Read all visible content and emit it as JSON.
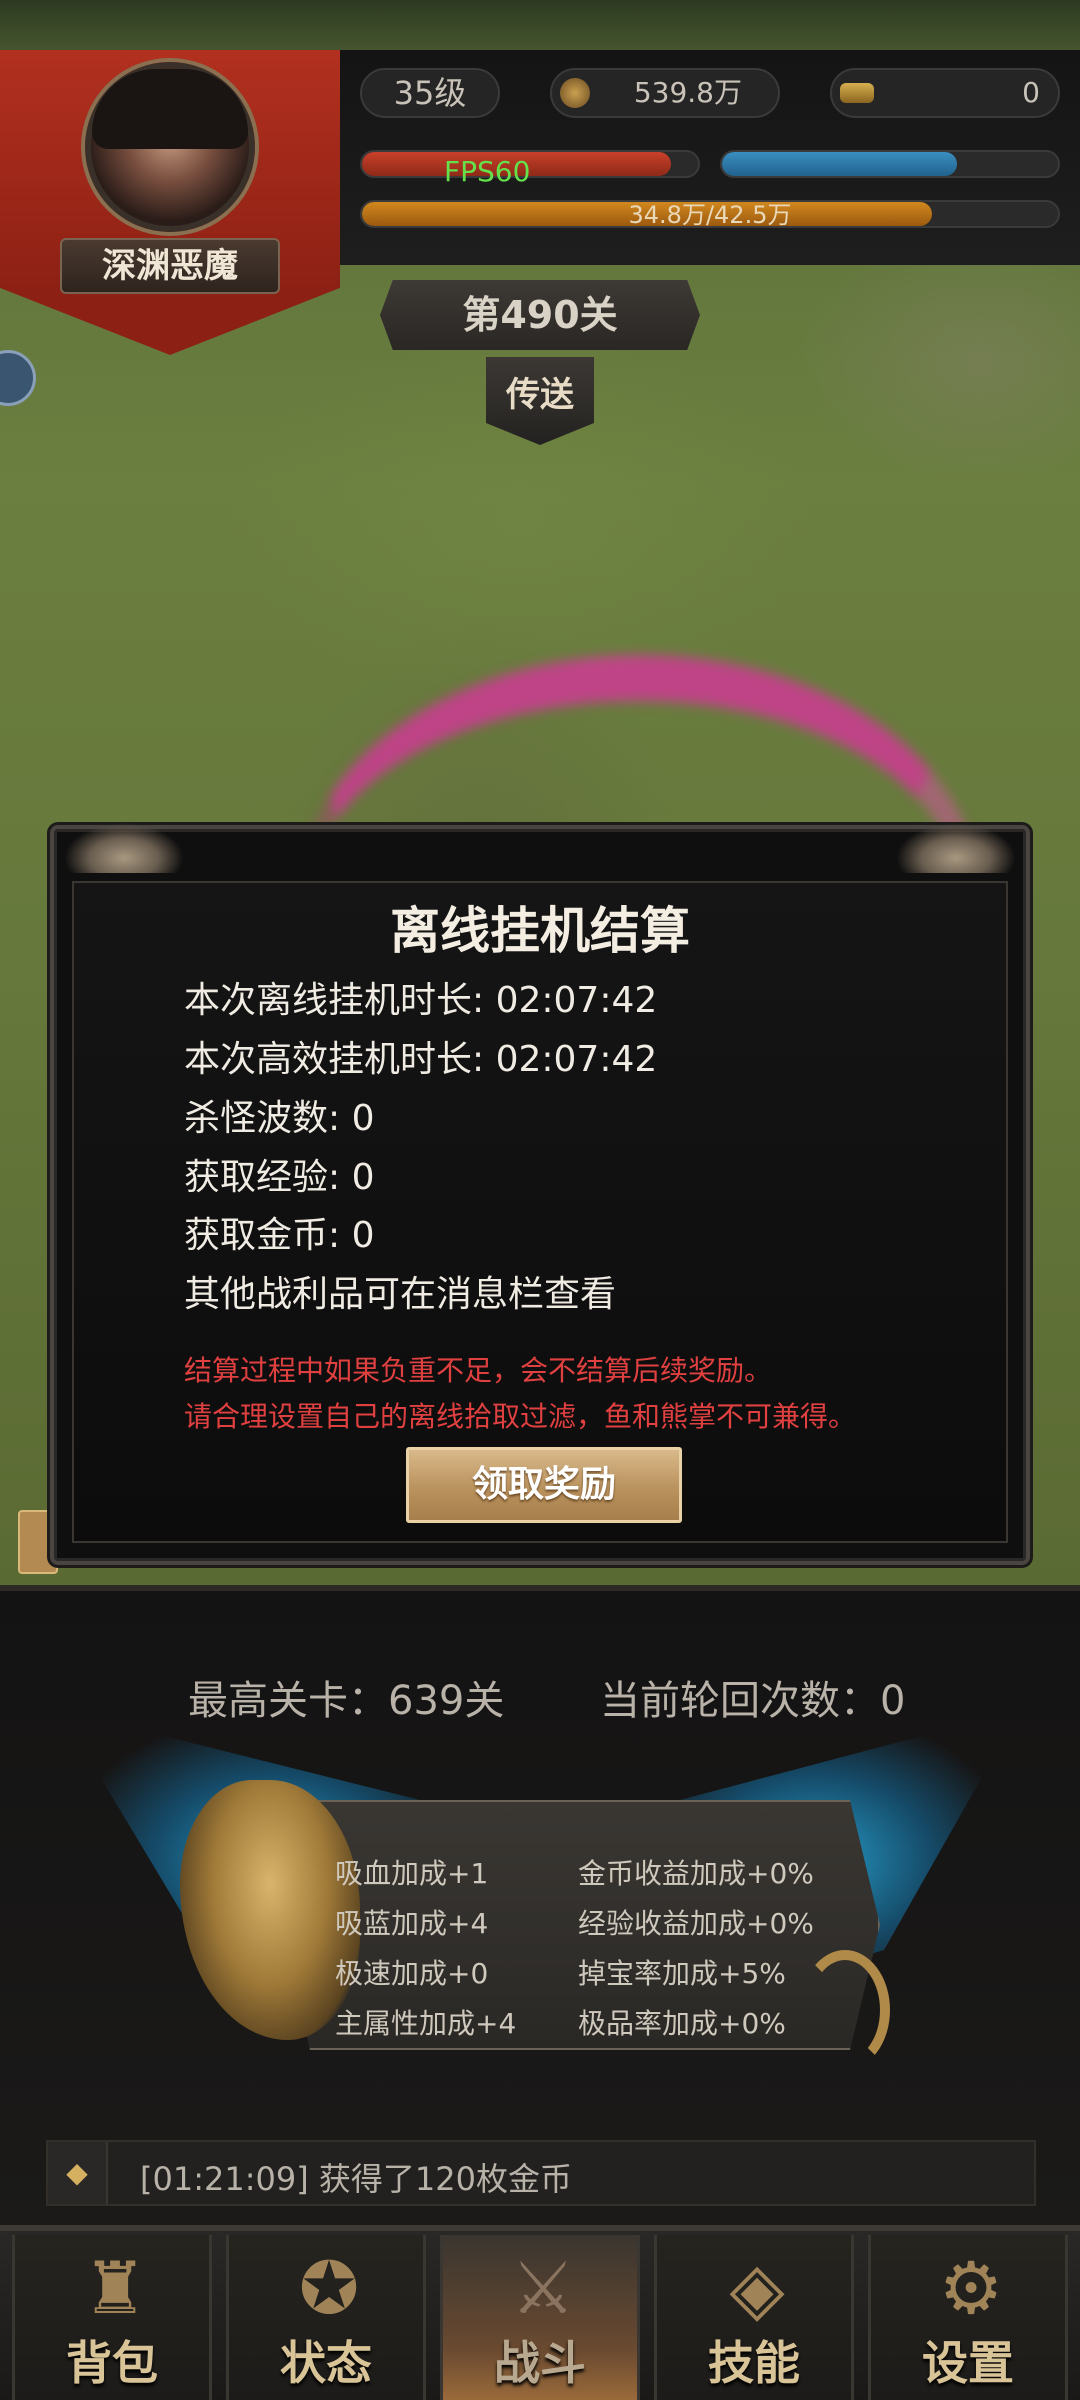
{
  "player": {
    "name": "深渊恶魔",
    "level": "35级",
    "gold": "539.8万",
    "ingots": "0",
    "fps": "FPS60",
    "hp_fraction": 0.92,
    "mp_fraction": 0.7,
    "xp_text": "34.8万/42.5万",
    "xp_fraction": 0.819
  },
  "stage": {
    "label": "第490关",
    "teleport_label": "传送"
  },
  "modal": {
    "title": "离线挂机结算",
    "lines": [
      "本次离线挂机时长: 02:07:42",
      "本次高效挂机时长: 02:07:42",
      "杀怪波数: 0",
      "获取经验: 0",
      "获取金币: 0",
      "其他战利品可在消息栏查看"
    ],
    "warnings": [
      "结算过程中如果负重不足，会不结算后续奖励。",
      "请合理设置自己的离线拾取过滤，鱼和熊掌不可兼得。"
    ],
    "claim_label": "领取奖励"
  },
  "panel": {
    "max_stage": "最高关卡：639关",
    "rebirth": "当前轮回次数：0",
    "attrs_left": [
      "吸血加成+1",
      "吸蓝加成+4",
      "极速加成+0",
      "主属性加成+4"
    ],
    "attrs_right": [
      "金币收益加成+0%",
      "经验收益加成+0%",
      "掉宝率加成+5%",
      "极品率加成+0%"
    ]
  },
  "log": {
    "message": "[01:21:09] 获得了120枚金币"
  },
  "tabs": [
    {
      "label": "背包",
      "icon": "bag-icon"
    },
    {
      "label": "状态",
      "icon": "status-icon"
    },
    {
      "label": "战斗",
      "icon": "battle-icon",
      "active": true
    },
    {
      "label": "技能",
      "icon": "skill-icon"
    },
    {
      "label": "设置",
      "icon": "gear-icon"
    }
  ],
  "colors": {
    "hp": "#c8402a",
    "mp": "#3a8ec0",
    "xp": "#d2881e",
    "warning": "#e04040",
    "fps": "#64e04a"
  }
}
